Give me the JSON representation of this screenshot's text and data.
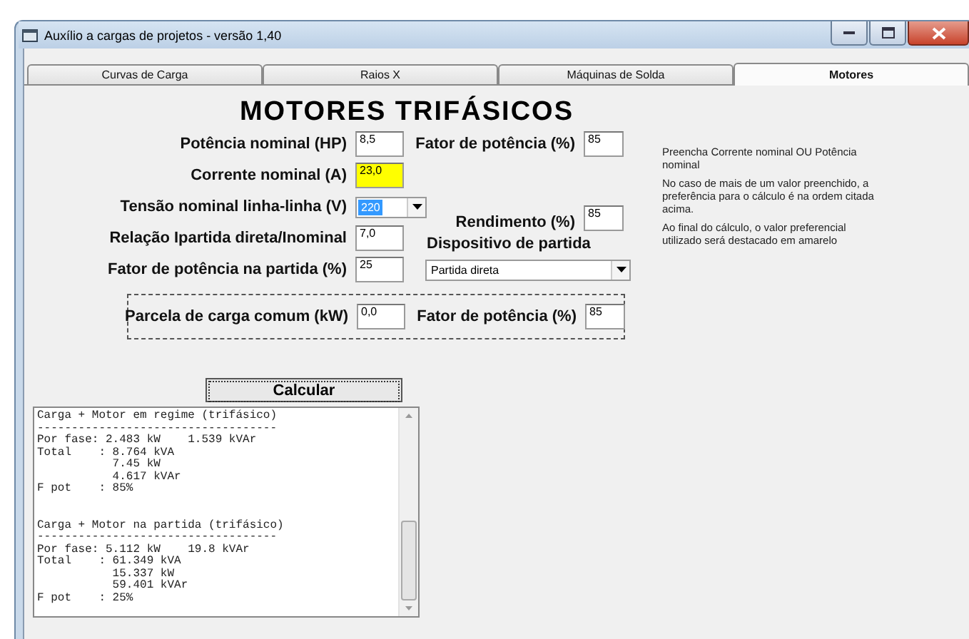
{
  "window": {
    "title": "Auxílio a cargas de projetos - versão 1,40"
  },
  "tabs": [
    {
      "label": "Curvas de Carga",
      "selected": false
    },
    {
      "label": "Raios X",
      "selected": false
    },
    {
      "label": "Máquinas de Solda",
      "selected": false
    },
    {
      "label": "Motores",
      "selected": true
    }
  ],
  "heading": "MOTORES TRIFÁSICOS",
  "form": {
    "power": {
      "label": "Potência nominal (HP)",
      "value": "8,5",
      "highlighted": false
    },
    "power_factor": {
      "label": "Fator de potência (%)",
      "value": "85"
    },
    "current": {
      "label": "Corrente nominal (A)",
      "value": "23,0",
      "highlighted": true
    },
    "voltage": {
      "label": "Tensão nominal linha-linha (V)",
      "value": "220",
      "focused": true
    },
    "efficiency": {
      "label": "Rendimento (%)",
      "value": "85"
    },
    "ratio": {
      "label": "Relação Ipartida direta/Inominal",
      "value": "7,0"
    },
    "start_power_factor": {
      "label": "Fator de potência na partida (%)",
      "value": "25"
    },
    "starter": {
      "label": "Dispositivo de partida",
      "value": "Partida direta"
    }
  },
  "common_load": {
    "load": {
      "label": "Parcela de carga comum (kW)",
      "value": "0,0"
    },
    "power_factor": {
      "label": "Fator de potência (%)",
      "value": "85"
    }
  },
  "help_notes": [
    "Preencha Corrente nominal OU Potência nominal",
    "No caso de mais de um valor preenchido, a preferência para o cálculo é na ordem citada acima.",
    "Ao final do cálculo, o valor preferencial utilizado será destacado em amarelo"
  ],
  "calculate_button": "Calcular",
  "output": {
    "blocks": [
      {
        "lines": [
          "Carga + Motor em regime (trifásico)",
          "-----------------------------------",
          "Por fase: 2.483 kW    1.539 kVAr",
          "Total    : 8.764 kVA",
          "           7.45 kW",
          "           4.617 kVAr",
          "F pot    : 85%"
        ]
      },
      {
        "lines": [
          "Carga + Motor na partida (trifásico)",
          "-----------------------------------",
          "Por fase: 5.112 kW    19.8 kVAr",
          "Total    : 61.349 kVA",
          "           15.337 kW",
          "           59.401 kVAr",
          "F pot    : 25%"
        ]
      }
    ]
  }
}
